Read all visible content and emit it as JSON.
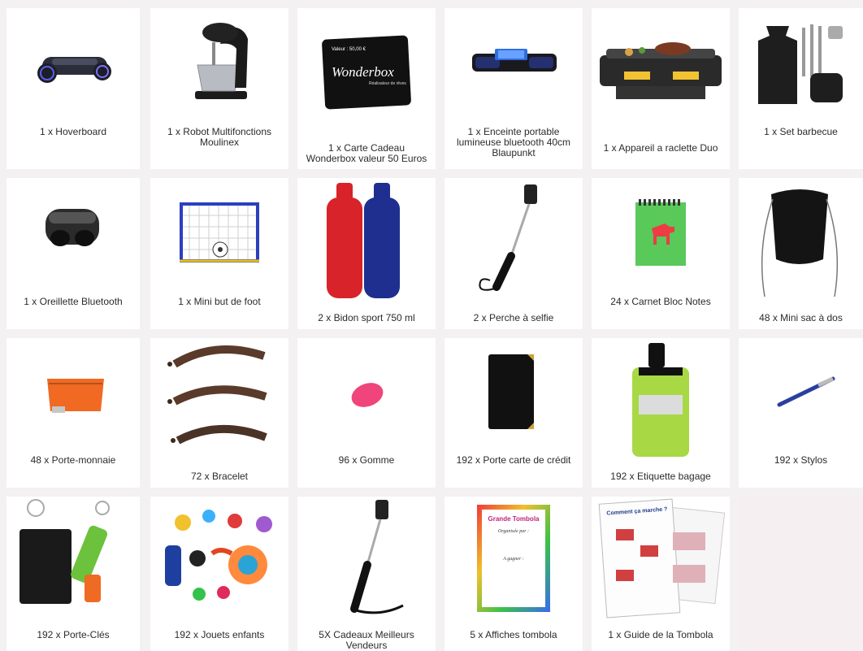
{
  "items": [
    {
      "label": "1 x Hoverboard",
      "icon": "hoverboard-icon"
    },
    {
      "label": "1 x Robot Multifonctions Moulinex",
      "icon": "stand-mixer-icon"
    },
    {
      "label": "1 x Carte Cadeau Wonderbox valeur 50 Euros",
      "icon": "gift-card-icon",
      "card_value": "Valeur : 50,00 €",
      "card_brand": "Wonderbox",
      "card_tagline": "Réalisateur de rêves"
    },
    {
      "label": "1 x Enceinte portable lumineuse bluetooth 40cm Blaupunkt",
      "icon": "bluetooth-speaker-icon"
    },
    {
      "label": "1 x Appareil a raclette Duo",
      "icon": "raclette-grill-icon"
    },
    {
      "label": "1 x Set barbecue",
      "icon": "barbecue-set-icon"
    },
    {
      "label": "1 x Oreillette Bluetooth",
      "icon": "earbuds-icon"
    },
    {
      "label": "1 x Mini but de foot",
      "icon": "football-goal-icon"
    },
    {
      "label": "2 x Bidon sport 750 ml",
      "icon": "sport-bottles-icon"
    },
    {
      "label": "2 x Perche à selfie",
      "icon": "selfie-stick-icon"
    },
    {
      "label": "24 x Carnet Bloc Notes",
      "icon": "notebook-icon"
    },
    {
      "label": "48 x Mini sac à dos",
      "icon": "drawstring-bag-icon"
    },
    {
      "label": "48 x Porte-monnaie",
      "icon": "coin-purse-icon"
    },
    {
      "label": "72 x Bracelet",
      "icon": "bracelet-icon"
    },
    {
      "label": "96 x Gomme",
      "icon": "eraser-icon"
    },
    {
      "label": "192 x Porte carte de crédit",
      "icon": "card-holder-icon"
    },
    {
      "label": "192 x Etiquette bagage",
      "icon": "luggage-tag-icon"
    },
    {
      "label": "192 x Stylos",
      "icon": "pen-icon"
    },
    {
      "label": "192 x Porte-Clés",
      "icon": "keychain-icon"
    },
    {
      "label": "192 x Jouets enfants",
      "icon": "kids-toys-icon"
    },
    {
      "label": "5X Cadeaux Meilleurs Vendeurs",
      "icon": "selfie-stick-icon"
    },
    {
      "label": "5 x Affiches tombola",
      "icon": "raffle-poster-icon",
      "poster_title": "Grande Tombola",
      "poster_line1": "Organisée par :",
      "poster_line2": "A gagner :"
    },
    {
      "label": "1 x Guide de la Tombola",
      "icon": "guide-leaflet-icon",
      "guide_title": "Comment ça marche ?"
    }
  ],
  "colors": {
    "background": "#f3f1f2",
    "card": "#ffffff",
    "text": "#2b2b2b"
  }
}
